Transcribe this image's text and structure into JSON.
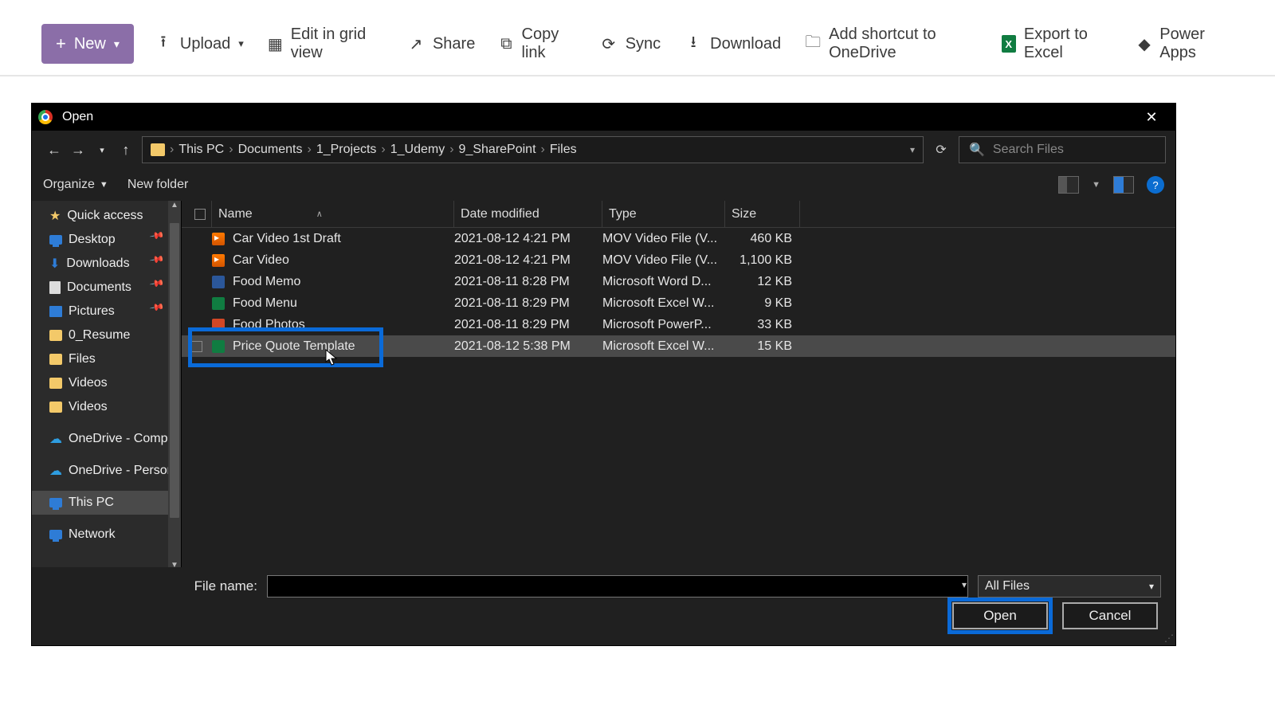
{
  "sp": {
    "new": "New",
    "upload": "Upload",
    "edit_grid": "Edit in grid view",
    "share": "Share",
    "copy_link": "Copy link",
    "sync": "Sync",
    "download": "Download",
    "shortcut": "Add shortcut to OneDrive",
    "export": "Export to Excel",
    "power": "Power Apps"
  },
  "dlg": {
    "title": "Open",
    "breadcrumb": [
      "This PC",
      "Documents",
      "1_Projects",
      "1_Udemy",
      "9_SharePoint",
      "Files"
    ],
    "search_placeholder": "Search Files",
    "organize": "Organize",
    "new_folder": "New folder",
    "file_name_label": "File name:",
    "filter": "All Files",
    "open_btn": "Open",
    "cancel_btn": "Cancel"
  },
  "side": [
    {
      "label": "Quick access",
      "icon": "star",
      "pin": false
    },
    {
      "label": "Desktop",
      "icon": "mon",
      "pin": true
    },
    {
      "label": "Downloads",
      "icon": "dl",
      "pin": true
    },
    {
      "label": "Documents",
      "icon": "doc",
      "pin": true
    },
    {
      "label": "Pictures",
      "icon": "pic",
      "pin": true
    },
    {
      "label": "0_Resume",
      "icon": "fold",
      "pin": false
    },
    {
      "label": "Files",
      "icon": "fold",
      "pin": false
    },
    {
      "label": "Videos",
      "icon": "fold",
      "pin": false
    },
    {
      "label": "Videos",
      "icon": "fold",
      "pin": false
    },
    {
      "label": "OneDrive - Comp",
      "icon": "cloud",
      "pin": false,
      "gap": true
    },
    {
      "label": "OneDrive - Persor",
      "icon": "cloud",
      "pin": false,
      "gap": true
    },
    {
      "label": "This PC",
      "icon": "mon",
      "pin": false,
      "sel": true,
      "gap": true
    },
    {
      "label": "Network",
      "icon": "mon",
      "pin": false,
      "gap": true
    }
  ],
  "cols": {
    "name": "Name",
    "date": "Date modified",
    "type": "Type",
    "size": "Size"
  },
  "rows": [
    {
      "icon": "mov",
      "name": "Car Video 1st Draft",
      "date": "2021-08-12 4:21 PM",
      "type": "MOV Video File (V...",
      "size": "460 KB",
      "sel": false
    },
    {
      "icon": "mov",
      "name": "Car Video",
      "date": "2021-08-12 4:21 PM",
      "type": "MOV Video File (V...",
      "size": "1,100 KB",
      "sel": false
    },
    {
      "icon": "word",
      "name": "Food Memo",
      "date": "2021-08-11 8:28 PM",
      "type": "Microsoft Word D...",
      "size": "12 KB",
      "sel": false
    },
    {
      "icon": "xl",
      "name": "Food Menu",
      "date": "2021-08-11 8:29 PM",
      "type": "Microsoft Excel W...",
      "size": "9 KB",
      "sel": false
    },
    {
      "icon": "ppt",
      "name": "Food Photos",
      "date": "2021-08-11 8:29 PM",
      "type": "Microsoft PowerP...",
      "size": "33 KB",
      "sel": false
    },
    {
      "icon": "xl",
      "name": "Price Quote Template",
      "date": "2021-08-12 5:38 PM",
      "type": "Microsoft Excel W...",
      "size": "15 KB",
      "sel": true
    }
  ]
}
